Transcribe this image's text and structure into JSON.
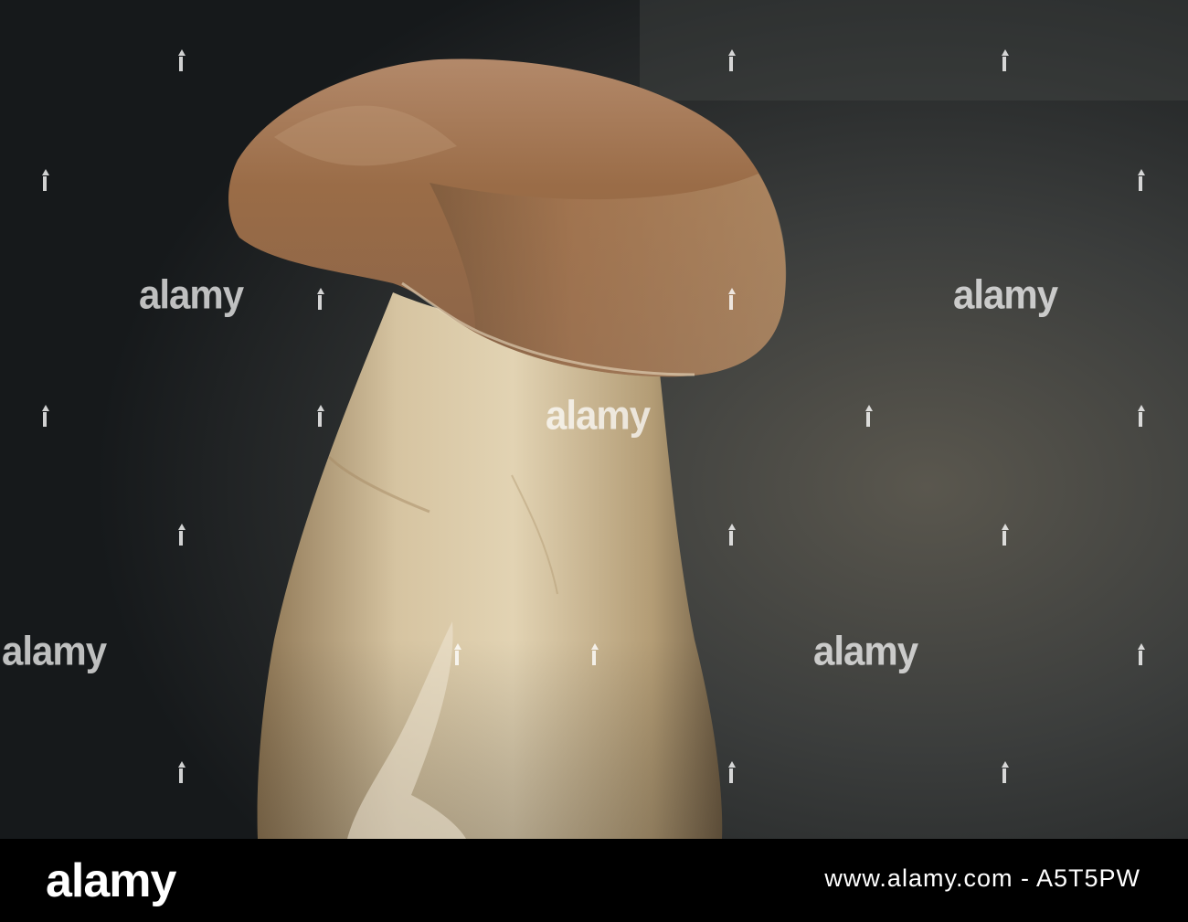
{
  "image": {
    "subject": "mushroom",
    "background_color": "#1a1d1f",
    "cap_color": "#9a6c47",
    "stem_color": "#d8c8a6"
  },
  "watermark": {
    "word": "alamy"
  },
  "footer": {
    "logo": "alamy",
    "image_id": "www.alamy.com - A5T5PW"
  }
}
